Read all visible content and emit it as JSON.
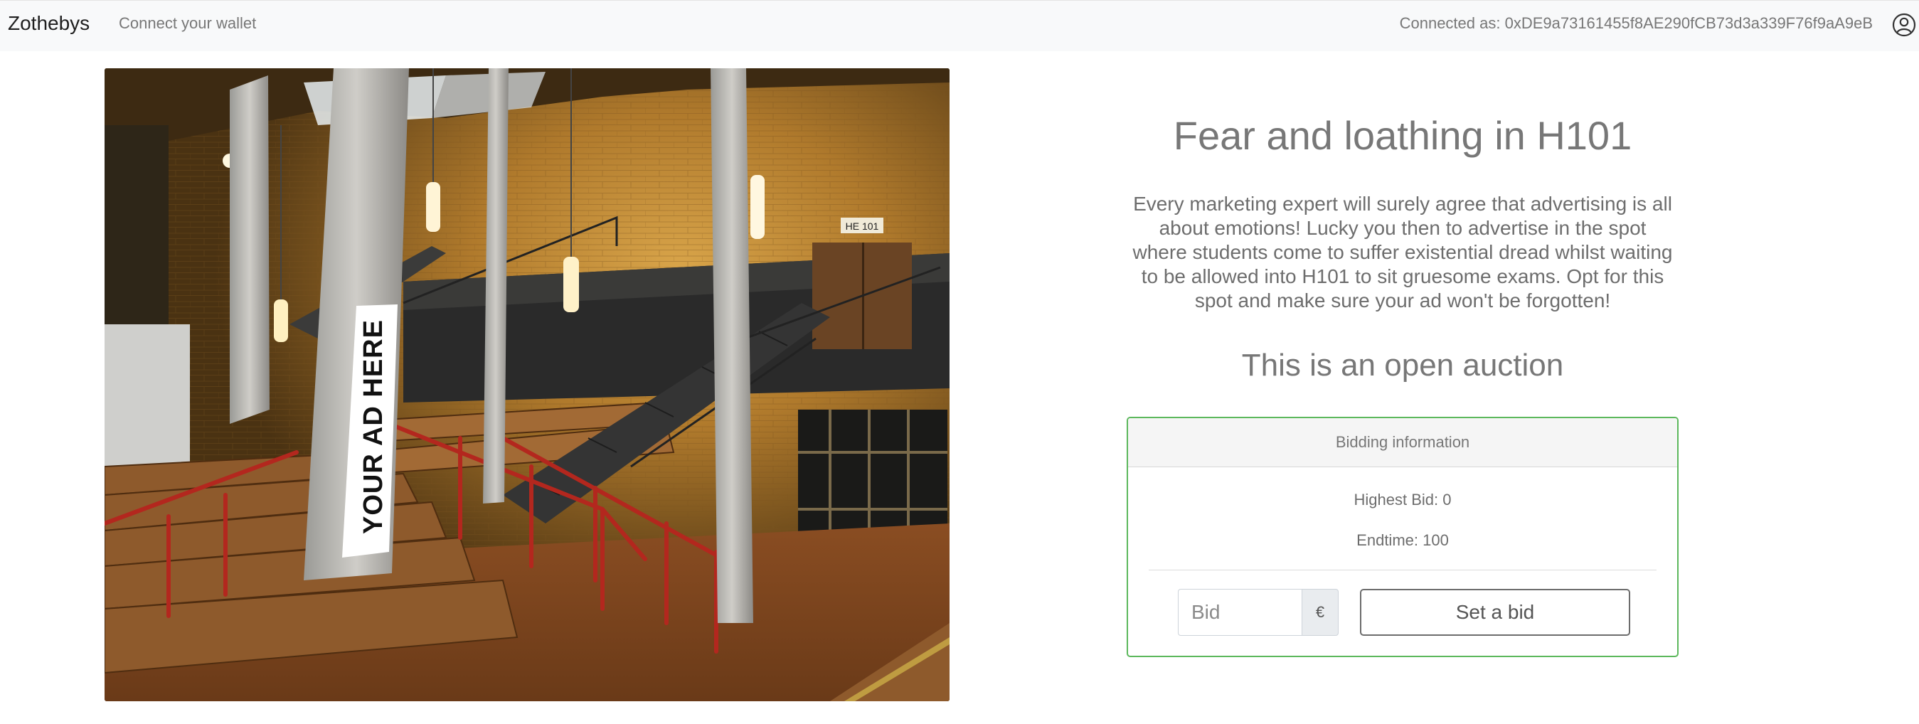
{
  "navbar": {
    "brand": "Zothebys",
    "connect_link": "Connect your wallet",
    "connected_label": "Connected as: 0xDE9a73161455f8AE290fCB73d3a339F76f9aA9eB",
    "user_icon": "user-circle-icon"
  },
  "image": {
    "banner_text": "YOUR AD HERE",
    "room_sign": "HE 101"
  },
  "listing": {
    "title": "Fear and loathing in H101",
    "description": "Every marketing expert will surely agree that advertising is all about emotions! Lucky you then to advertise in the spot where students come to suffer existential dread whilst waiting to be allowed into H101 to sit gruesome exams. Opt for this spot and make sure your ad won't be forgotten!",
    "auction_type": "This is an open auction"
  },
  "bidding": {
    "header": "Bidding information",
    "highest_bid": "Highest Bid: 0",
    "endtime": "Endtime: 100",
    "bid_placeholder": "Bid",
    "currency": "€",
    "button_label": "Set a bid"
  },
  "colors": {
    "card_border": "#5cb85c",
    "navbar_bg": "#f8f9fa"
  }
}
